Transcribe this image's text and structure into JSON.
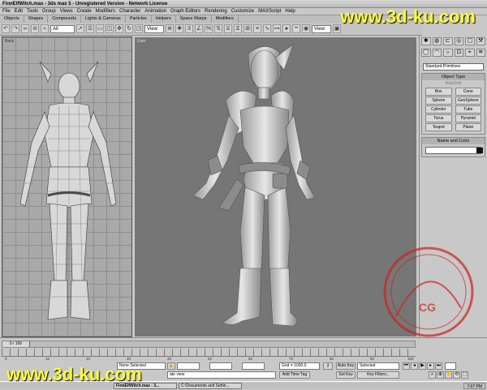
{
  "window": {
    "title": "FinnElfWitch.max - 3ds max 5 - Unregistered Version - Network License"
  },
  "menu": [
    "File",
    "Edit",
    "Tools",
    "Group",
    "Views",
    "Create",
    "Modifiers",
    "Character",
    "Animation",
    "Graph Editors",
    "Rendering",
    "Customize",
    "MAXScript",
    "Help"
  ],
  "tabs": [
    "Objects",
    "Shapes",
    "Compounds",
    "Lights & Cameras",
    "Particles",
    "Helpers",
    "Space Warps",
    "Modifiers"
  ],
  "toolbar": {
    "filter": "All",
    "ref_coord": "View",
    "ref_coord2": "View"
  },
  "viewports": {
    "left_label": "Back",
    "main_label": "User"
  },
  "command_panel": {
    "category": "Standard Primitives",
    "object_type_title": "Object Type",
    "autogrid": "AutoGrid",
    "objects": [
      "Box",
      "Cone",
      "Sphere",
      "GeoSphere",
      "Cylinder",
      "Tube",
      "Torus",
      "Pyramid",
      "Teapot",
      "Plane"
    ],
    "name_color_title": "Name and Color"
  },
  "timeline": {
    "frame": "0 / 100",
    "ticks": [
      "0",
      "10",
      "20",
      "30",
      "40",
      "50",
      "60",
      "70",
      "80",
      "90",
      "100"
    ]
  },
  "status": {
    "selection": "None Selected",
    "grid": "Grid = 1000.0",
    "add_time_tag": "Add Time Tag",
    "auto_key": "Auto Key",
    "set_key": "Set Key",
    "key_filter_value": "Selected",
    "key_filters": "Key Filters...",
    "prompt": "ate view"
  },
  "taskbar": {
    "app": "FinnElfWitch.max - 3...",
    "explorer": "C:\\Documents and Settin...",
    "clock": "7:07 PM"
  },
  "watermark": {
    "top": "www.3d-ku.com",
    "bottom": "www.3d-ku.com",
    "stamp_text": "CG"
  },
  "colors": {
    "watermark": "#ffff33",
    "stamp": "#cc2222",
    "viewport_bg": "#767676"
  }
}
